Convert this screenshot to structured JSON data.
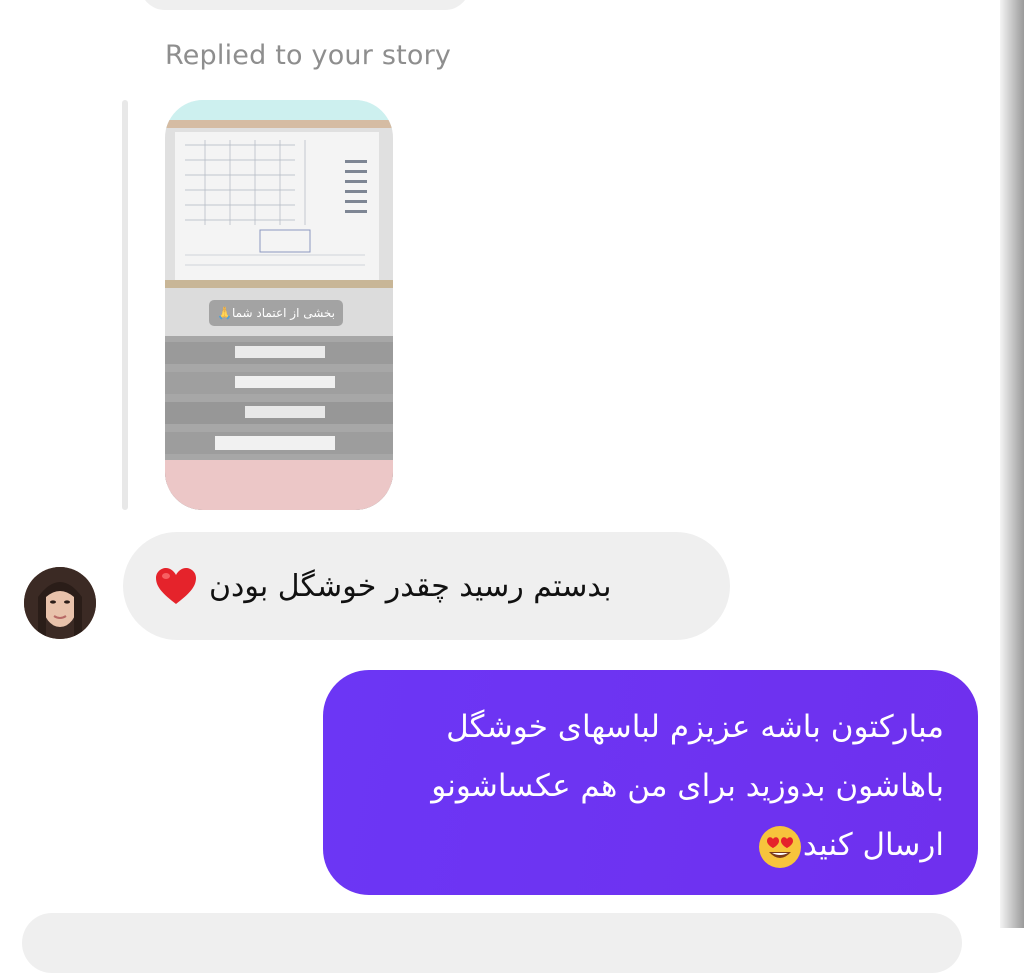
{
  "thread": {
    "reply_label": "Replied to your story",
    "story": {
      "caption": "بخشی از اعتماد شما🙏"
    },
    "incoming_message": {
      "text": "بدستم رسید چقدر خوشگل بودن",
      "emoji": "heart-icon"
    },
    "outgoing_message": {
      "line1": "مبارکتون باشه عزیزم لباسهای خوشگل",
      "line2": "باهاشون بدوزید برای من هم عکساشونو",
      "line3": "ارسال کنید",
      "emoji": "heart-eyes-face-icon"
    }
  },
  "colors": {
    "outgoing_bubble": "#6c36f5",
    "incoming_bubble": "#efefef",
    "secondary_text": "#8e8e8e"
  }
}
